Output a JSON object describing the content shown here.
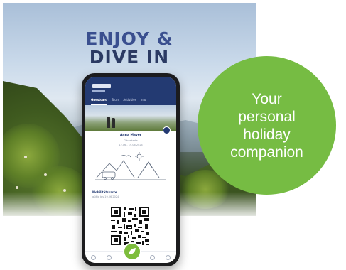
{
  "poster": {
    "headline_line1": "ENJOY &",
    "headline_line2": "DIVE IN",
    "colors": {
      "headline1": "#3a4f8f",
      "headline2": "#2b3a63"
    }
  },
  "app": {
    "tabs": [
      "Guestcard",
      "Tours",
      "Activities",
      "Info"
    ],
    "holder_name": "Anna Mayer",
    "holder_sub": "Gästekarte",
    "holder_date": "12.06 - 19.06.2024",
    "section_title": "Mobilitätskarte",
    "section_sub": "gültig bis 19.06.2024",
    "colors": {
      "header": "#233a72",
      "accent": "#7dbd3c"
    }
  },
  "badge": {
    "line1": "Your",
    "line2": "personal",
    "line3": "holiday",
    "line4": "companion",
    "color": "#76bc43"
  }
}
